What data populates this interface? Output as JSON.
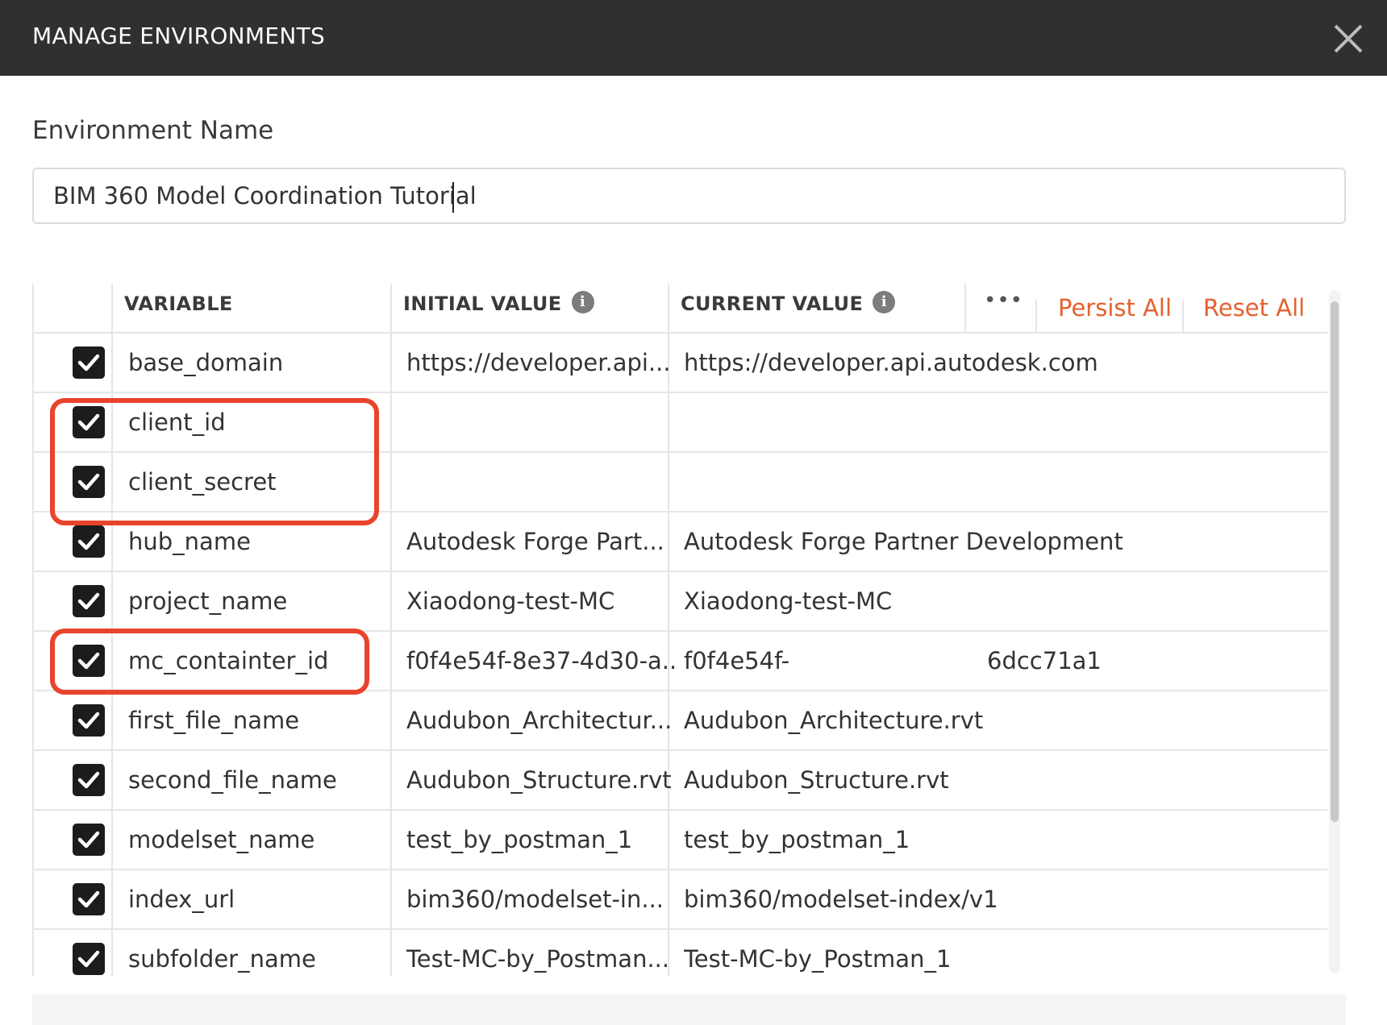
{
  "dialog": {
    "title": "MANAGE ENVIRONMENTS",
    "close_icon": "close-icon"
  },
  "environment": {
    "label": "Environment Name",
    "value": "BIM 360 Model Coordination Tutorial"
  },
  "table": {
    "headers": {
      "variable": "VARIABLE",
      "initial_value": "INITIAL VALUE",
      "current_value": "CURRENT VALUE",
      "info_icon": "i"
    },
    "actions": {
      "more": "•••",
      "persist_all": "Persist All",
      "reset_all": "Reset All"
    },
    "rows": [
      {
        "variable": "base_domain",
        "initial": "https://developer.api...",
        "current": "https://developer.api.autodesk.com",
        "checked": true
      },
      {
        "variable": "client_id",
        "initial": "",
        "current": "",
        "checked": true
      },
      {
        "variable": "client_secret",
        "initial": "",
        "current": "",
        "checked": true
      },
      {
        "variable": "hub_name",
        "initial": "Autodesk Forge Part...",
        "current": "Autodesk Forge Partner Development",
        "checked": true
      },
      {
        "variable": "project_name",
        "initial": "Xiaodong-test-MC",
        "current": "Xiaodong-test-MC",
        "checked": true
      },
      {
        "variable": "mc_containter_id",
        "initial": "f0f4e54f-8e37-4d30-a...",
        "current": "f0f4e54f-",
        "current_tail": "6dcc71a1",
        "checked": true
      },
      {
        "variable": "first_file_name",
        "initial": "Audubon_Architectur...",
        "current": "Audubon_Architecture.rvt",
        "checked": true
      },
      {
        "variable": "second_file_name",
        "initial": "Audubon_Structure.rvt",
        "current": "Audubon_Structure.rvt",
        "checked": true
      },
      {
        "variable": "modelset_name",
        "initial": "test_by_postman_1",
        "current": "test_by_postman_1",
        "checked": true
      },
      {
        "variable": "index_url",
        "initial": "bim360/modelset-in...",
        "current": "bim360/modelset-index/v1",
        "checked": true
      },
      {
        "variable": "subfolder_name",
        "initial": "Test-MC-by_Postman...",
        "current": "Test-MC-by_Postman_1",
        "checked": true
      }
    ]
  },
  "colors": {
    "titlebar": "#303030",
    "accent": "#e5612e",
    "highlight": "#e8432d"
  }
}
